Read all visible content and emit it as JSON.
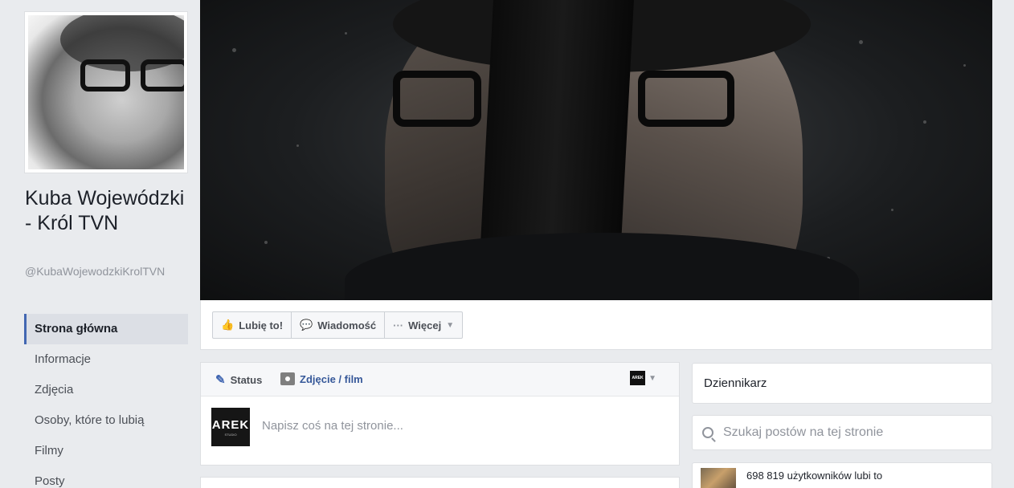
{
  "page": {
    "name": "Kuba Wojewódzki - Król TVN",
    "handle": "@KubaWojewodzkiKrolTVN"
  },
  "nav": {
    "items": [
      {
        "label": "Strona główna"
      },
      {
        "label": "Informacje"
      },
      {
        "label": "Zdjęcia"
      },
      {
        "label": "Osoby, które to lubią"
      },
      {
        "label": "Filmy"
      },
      {
        "label": "Posty"
      }
    ],
    "active_index": 0
  },
  "actions": {
    "like_label": "Lubię to!",
    "message_label": "Wiadomość",
    "more_label": "Więcej"
  },
  "composer": {
    "status_label": "Status",
    "photo_label": "Zdjęcie / film",
    "placeholder": "Napisz coś na tej stronie...",
    "avatar_text": "AREK",
    "avatar_small": "STUDIO"
  },
  "sidebar": {
    "category": "Dziennikarz",
    "search_placeholder": "Szukaj postów na tej stronie",
    "likes_text": "698 819 użytkowników lubi to"
  },
  "colors": {
    "accent": "#4267b2",
    "link": "#365899",
    "background": "#e9ebee"
  }
}
